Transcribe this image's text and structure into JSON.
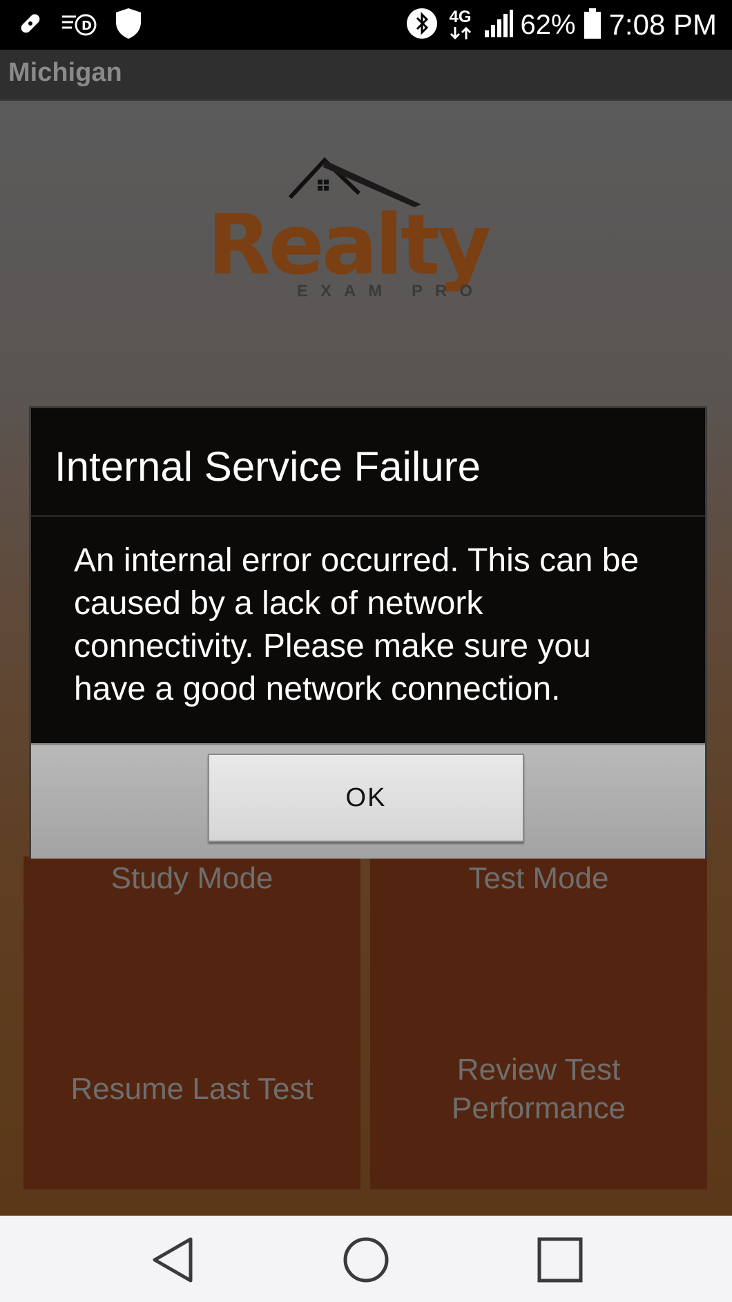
{
  "status_bar": {
    "network_label": "4G",
    "battery_percent": "62%",
    "time": "7:08 PM",
    "icons": [
      "bandage-icon",
      "speed-d-icon",
      "shield-icon",
      "bluetooth-icon",
      "network-4g-icon",
      "signal-icon",
      "battery-icon"
    ]
  },
  "app_bar": {
    "title": "Michigan"
  },
  "logo": {
    "word": "Realty",
    "tagline": "EXAM PRO"
  },
  "tiles": [
    {
      "label": "Study Mode"
    },
    {
      "label": "Test Mode"
    },
    {
      "label": "Resume Last Test"
    },
    {
      "label": "Review Test Performance"
    }
  ],
  "dialog": {
    "title": "Internal Service Failure",
    "message": "An internal error occurred. This can be caused by a lack of network connectivity. Please make sure you have a good network connection.",
    "ok_label": "OK"
  },
  "nav_bar": {
    "icons": [
      "back-icon",
      "home-icon",
      "recents-icon"
    ]
  },
  "colors": {
    "tile": "#532510",
    "dialog_bg": "#0b0a08",
    "nav_bg": "#f4f4f6"
  }
}
